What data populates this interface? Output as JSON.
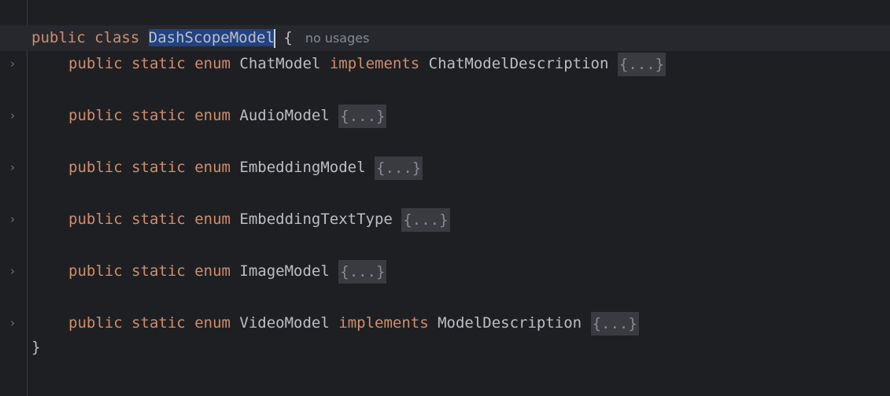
{
  "editor": {
    "class_line": {
      "kw1": "public",
      "kw2": "class",
      "name": "DashScopeModel",
      "brace": "{",
      "usage_hint": "no usages"
    },
    "enums": [
      {
        "kw1": "public",
        "kw2": "static",
        "kw3": "enum",
        "name": "ChatModel",
        "implements_kw": "implements",
        "interface": "ChatModelDescription",
        "folded": "{...}"
      },
      {
        "kw1": "public",
        "kw2": "static",
        "kw3": "enum",
        "name": "AudioModel",
        "implements_kw": "",
        "interface": "",
        "folded": "{...}"
      },
      {
        "kw1": "public",
        "kw2": "static",
        "kw3": "enum",
        "name": "EmbeddingModel",
        "implements_kw": "",
        "interface": "",
        "folded": "{...}"
      },
      {
        "kw1": "public",
        "kw2": "static",
        "kw3": "enum",
        "name": "EmbeddingTextType",
        "implements_kw": "",
        "interface": "",
        "folded": "{...}"
      },
      {
        "kw1": "public",
        "kw2": "static",
        "kw3": "enum",
        "name": "ImageModel",
        "implements_kw": "",
        "interface": "",
        "folded": "{...}"
      },
      {
        "kw1": "public",
        "kw2": "static",
        "kw3": "enum",
        "name": "VideoModel",
        "implements_kw": "implements",
        "interface": "ModelDescription",
        "folded": "{...}"
      }
    ],
    "closing_brace": "}",
    "fold_icon": "chevron-right-icon",
    "colors": {
      "background": "#1e1f22",
      "keyword": "#cf8e6d",
      "identifier": "#bcbec4",
      "selection": "#214283",
      "folded_region": "#393b40",
      "current_line": "#26282e"
    }
  }
}
